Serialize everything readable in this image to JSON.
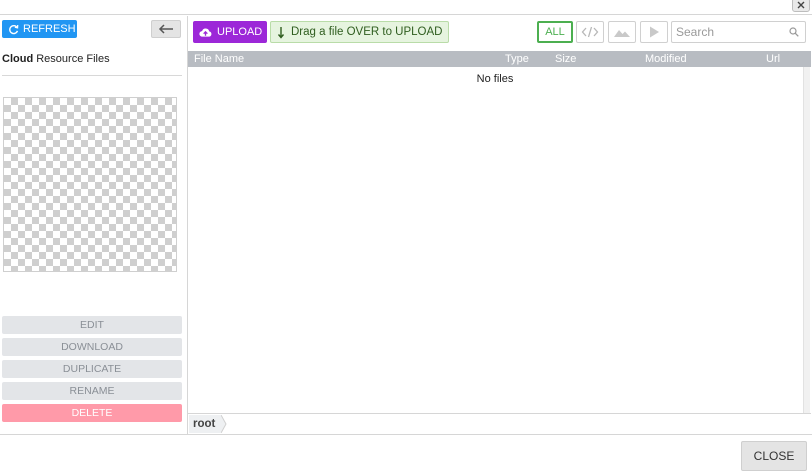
{
  "window": {
    "close_icon": "close-icon"
  },
  "sidebar": {
    "refresh_label": "REFRESH",
    "refresh_icon": "refresh-icon",
    "back_icon": "arrow-left-icon",
    "title_bold": "Cloud",
    "title_rest": " Resource Files",
    "actions": {
      "edit": "EDIT",
      "download": "DOWNLOAD",
      "duplicate": "DUPLICATE",
      "rename": "RENAME",
      "delete": "DELETE"
    }
  },
  "toolbar": {
    "upload_label": "UPLOAD",
    "upload_icon": "cloud-upload-icon",
    "drop_label": "Drag a file OVER to UPLOAD",
    "drop_icon": "arrow-down-icon",
    "filters": {
      "all": "ALL",
      "code_icon": "code-icon",
      "image_icon": "image-icon",
      "video_icon": "play-icon"
    },
    "search_placeholder": "Search",
    "search_icon": "search-icon"
  },
  "table": {
    "columns": {
      "name": "File Name",
      "type": "Type",
      "size": "Size",
      "modified": "Modified",
      "url": "Url"
    },
    "empty_text": "No files"
  },
  "breadcrumb": {
    "root": "root"
  },
  "footer": {
    "close_label": "CLOSE"
  },
  "colors": {
    "refresh": "#2196f3",
    "upload": "#9c27d8",
    "drop_zone": "#e6f4df",
    "filter_active": "#4caf50",
    "delete": "#ff9aa9",
    "table_header": "#b8bcc2"
  }
}
